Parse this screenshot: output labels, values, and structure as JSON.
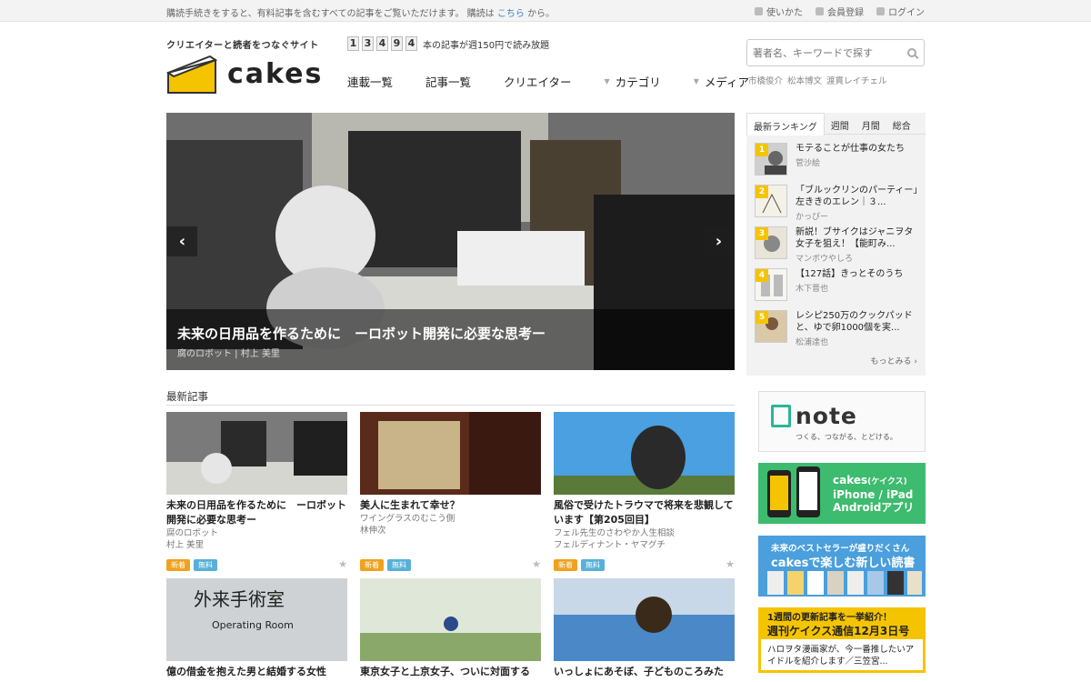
{
  "topbar": {
    "message_prefix": "購読手続きをすると、有料記事を含むすべての記事をご覧いただけます。 購読は",
    "message_link": "こちら",
    "message_suffix": "から。",
    "links": [
      "使いかた",
      "会員登録",
      "ログイン"
    ]
  },
  "header": {
    "tagline": "クリエイターと読者をつなぐサイト",
    "logo_text": "cakes",
    "counter_digits": [
      "1",
      "3",
      "4",
      "9",
      "4"
    ],
    "counter_text": "本の記事が週150円で読み放題",
    "nav": [
      "連載一覧",
      "記事一覧",
      "クリエイター",
      "カテゴリ",
      "メディア"
    ],
    "search_placeholder": "著者名、キーワードで探す",
    "keywords": [
      "市橋俊介",
      "松本博文",
      "渡貫レイチェル"
    ]
  },
  "hero": {
    "title": "未来の日用品を作るために　ーロボット開発に必要な思考ー",
    "subtitle": "腐のロボット | 村上 美里"
  },
  "ranking": {
    "tabs": [
      "最新ランキング",
      "週間",
      "月間",
      "総合"
    ],
    "items": [
      {
        "num": "1",
        "title": "モテることが仕事の女たち",
        "author": "菅沙絵"
      },
      {
        "num": "2",
        "title": "「ブルックリンのパーティー」左ききのエレン｜３...",
        "author": "かっぴー"
      },
      {
        "num": "3",
        "title": "新説！ブサイクはジャニヲタ女子を狙え！【能町み...",
        "author": "マンボウやしろ"
      },
      {
        "num": "4",
        "title": "【127話】きっとそのうち",
        "author": "木下晋也"
      },
      {
        "num": "5",
        "title": "レシピ250万のクックパッドと、ゆで卵1000個を実...",
        "author": "松浦達也"
      }
    ],
    "more": "もっとみる ›"
  },
  "latest": {
    "heading": "最新記事",
    "cards": [
      {
        "title": "未来の日用品を作るために　ーロボット開発に必要な思考ー",
        "series": "腐のロボット",
        "author": "村上 美里",
        "tags": [
          "新着",
          "無料"
        ]
      },
      {
        "title": "美人に生まれて幸せ？",
        "series": "ワイングラスのむこう側",
        "author": "林伸次",
        "tags": [
          "新着",
          "無料"
        ]
      },
      {
        "title": "風俗で受けたトラウマで将来を悲観しています【第205回目】",
        "series": "フェル先生のさわやか人生相談",
        "author": "フェルディナント・ヤマグチ",
        "tags": [
          "新着",
          "無料"
        ]
      },
      {
        "title": "億の借金を抱えた男と結婚する女性",
        "series": "",
        "author": "",
        "tags": []
      },
      {
        "title": "東京女子と上京女子、ついに対面する",
        "series": "",
        "author": "",
        "tags": []
      },
      {
        "title": "いっしょにあそぼ、子どものころみた",
        "series": "",
        "author": "",
        "tags": []
      }
    ]
  },
  "sidebar": {
    "note_title": "note",
    "note_sub": "つくる、つながる、とどける。",
    "app_line1": "cakes",
    "app_line1_sub": "(ケイクス)",
    "app_line2": "iPhone / iPad",
    "app_line3": "Androidアプリ",
    "read_line1": "未来のベストセラーが盛りだくさん",
    "read_line2": "cakesで楽しむ新しい読書",
    "weekly_head1": "1週間の更新記事を一挙紹介！",
    "weekly_head2": "週刊ケイクス通信12月3日号",
    "weekly_text": "ハロヲタ漫画家が、今一番推したいアイドルを紹介します／三笠宮..."
  },
  "colors": {
    "accent": "#f5c400",
    "link": "#3a7fc4",
    "new_tag": "#f0a21d",
    "free_tag": "#58b0d8",
    "app_green": "#3dbb6e",
    "read_blue": "#4a9fdc"
  }
}
